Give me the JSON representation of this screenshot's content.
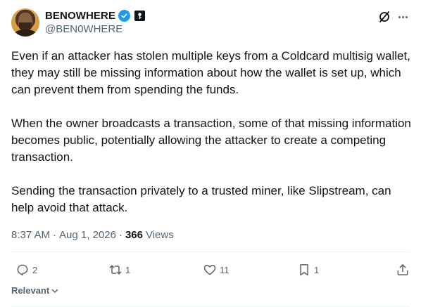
{
  "author": {
    "display_name": "BENOWHERE",
    "handle": "@BEN0WHERE"
  },
  "tweet": {
    "paragraphs": [
      "Even if an attacker has stolen multiple keys from a Coldcard multisig wallet, they may still be missing information about how the wallet is set up, which can prevent them from spending the funds.",
      "When the owner broadcasts a transaction, some of that missing information becomes public, potentially allowing the attacker to create a competing transaction.",
      "Sending the transaction privately to a trusted miner, like Slipstream, can help avoid that attack."
    ],
    "time": "8:37 AM",
    "date": "Aug 1, 2026",
    "views_count": "366",
    "views_label": "Views"
  },
  "actions": {
    "replies": "2",
    "reposts": "1",
    "likes": "11",
    "bookmarks": "1"
  },
  "sort": {
    "label": "Relevant"
  },
  "colors": {
    "accent": "#1d9bf0",
    "text": "#0f1419",
    "secondary": "#536471",
    "divider": "#eff3f4"
  },
  "icons": [
    "verified-badge-icon",
    "affiliate-badge-icon",
    "grok-icon",
    "more-icon",
    "reply-icon",
    "repost-icon",
    "like-icon",
    "bookmark-icon",
    "share-icon",
    "chevron-down-icon"
  ]
}
